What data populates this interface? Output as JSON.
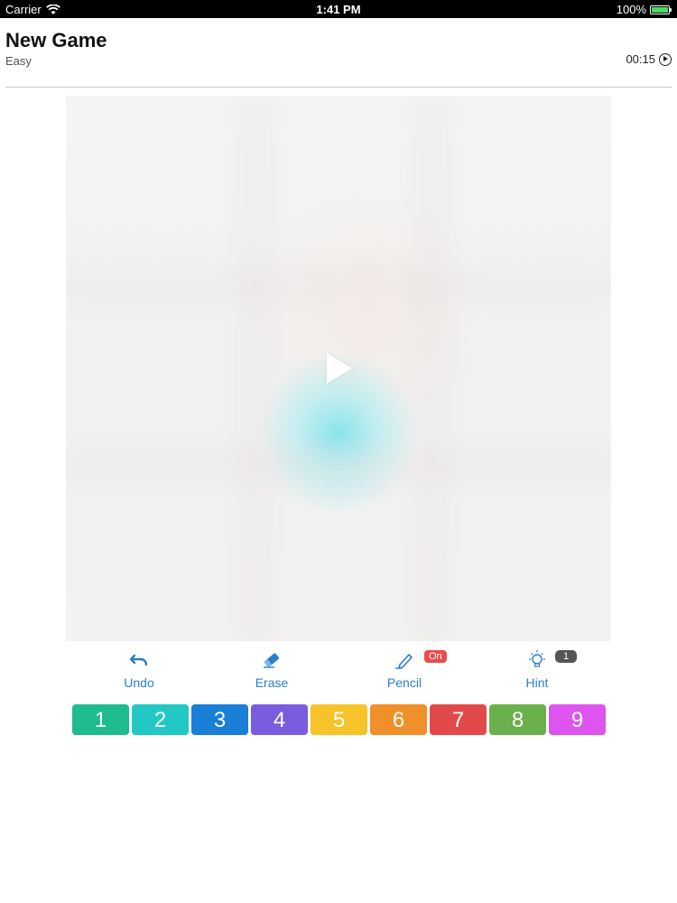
{
  "status_bar": {
    "carrier": "Carrier",
    "time": "1:41 PM",
    "battery": "100%"
  },
  "header": {
    "title": "New Game",
    "difficulty": "Easy",
    "timer": "00:15"
  },
  "board": {
    "state": "paused",
    "play_icon": "play-icon"
  },
  "toolbar": {
    "undo": {
      "label": "Undo",
      "icon": "undo-icon"
    },
    "erase": {
      "label": "Erase",
      "icon": "eraser-icon"
    },
    "pencil": {
      "label": "Pencil",
      "icon": "pencil-icon",
      "badge": "On"
    },
    "hint": {
      "label": "Hint",
      "icon": "lightbulb-icon",
      "badge": "1"
    }
  },
  "numpad": [
    {
      "label": "1",
      "color": "#1dbb8f"
    },
    {
      "label": "2",
      "color": "#22c9c4"
    },
    {
      "label": "3",
      "color": "#1a7fd6"
    },
    {
      "label": "4",
      "color": "#7b5cde"
    },
    {
      "label": "5",
      "color": "#f6c32a"
    },
    {
      "label": "6",
      "color": "#f0902a"
    },
    {
      "label": "7",
      "color": "#e24a4a"
    },
    {
      "label": "8",
      "color": "#6ab04c"
    },
    {
      "label": "9",
      "color": "#dd55ee"
    }
  ],
  "colors": {
    "accent": "#2a7fc9",
    "pencil_badge": "#e84c4c",
    "hint_badge": "#555555"
  }
}
